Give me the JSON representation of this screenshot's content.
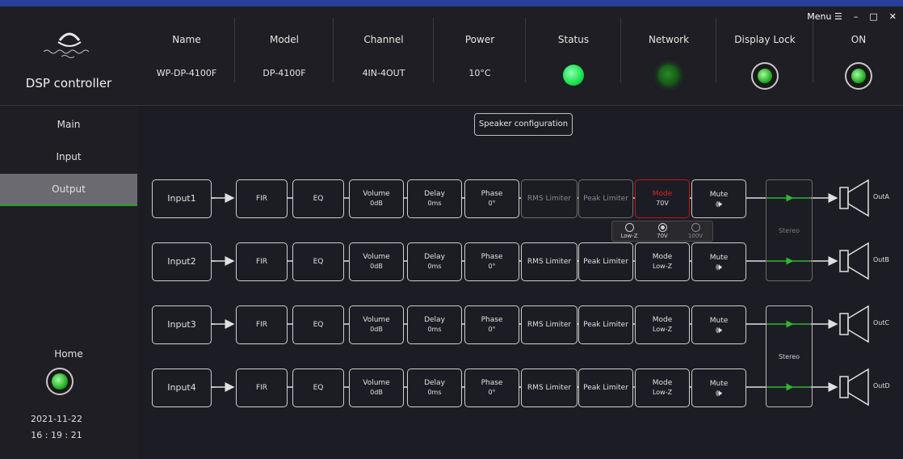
{
  "app": {
    "title": "DSP controller"
  },
  "window": {
    "menu_label": "Menu",
    "menu_icon": "☰",
    "minimize": "–",
    "maximize": "□",
    "close": "✕"
  },
  "header": {
    "name": {
      "label": "Name",
      "value": "WP-DP-4100F"
    },
    "model": {
      "label": "Model",
      "value": "DP-4100F"
    },
    "channel": {
      "label": "Channel",
      "value": "4IN-4OUT"
    },
    "power": {
      "label": "Power",
      "value": "10°C"
    },
    "status": {
      "label": "Status",
      "color": "#17e04a"
    },
    "network": {
      "label": "Network",
      "color": "#1a7a1a"
    },
    "display_lock": {
      "label": "Display Lock"
    },
    "on": {
      "label": "ON"
    }
  },
  "sidebar": {
    "items": [
      {
        "label": "Main"
      },
      {
        "label": "Input"
      },
      {
        "label": "Output",
        "active": true
      }
    ],
    "home_label": "Home",
    "date": "2021-11-22",
    "time": "16 : 19 : 21"
  },
  "main": {
    "speaker_config_label": "Speaker configuration",
    "channels": [
      {
        "input": "Input1",
        "fir": "FIR",
        "eq": "EQ",
        "volume": "Volume",
        "volume_val": "0dB",
        "delay": "Delay",
        "delay_val": "0ms",
        "phase": "Phase",
        "phase_val": "0°",
        "rms": "RMS Limiter",
        "peak": "Peak Limiter",
        "mode": "Mode",
        "mode_val": "70V",
        "mute": "Mute",
        "output": "OutA"
      },
      {
        "input": "Input2",
        "fir": "FIR",
        "eq": "EQ",
        "volume": "Volume",
        "volume_val": "0dB",
        "delay": "Delay",
        "delay_val": "0ms",
        "phase": "Phase",
        "phase_val": "0°",
        "rms": "RMS Limiter",
        "peak": "Peak Limiter",
        "mode": "Mode",
        "mode_val": "Low-Z",
        "mute": "Mute",
        "output": "OutB"
      },
      {
        "input": "Input3",
        "fir": "FIR",
        "eq": "EQ",
        "volume": "Volume",
        "volume_val": "0dB",
        "delay": "Delay",
        "delay_val": "0ms",
        "phase": "Phase",
        "phase_val": "0°",
        "rms": "RMS Limiter",
        "peak": "Peak Limiter",
        "mode": "Mode",
        "mode_val": "Low-Z",
        "mute": "Mute",
        "output": "OutC"
      },
      {
        "input": "Input4",
        "fir": "FIR",
        "eq": "EQ",
        "volume": "Volume",
        "volume_val": "0dB",
        "delay": "Delay",
        "delay_val": "0ms",
        "phase": "Phase",
        "phase_val": "0°",
        "rms": "RMS Limiter",
        "peak": "Peak Limiter",
        "mode": "Mode",
        "mode_val": "Low-Z",
        "mute": "Mute",
        "output": "OutD"
      }
    ],
    "stereo_label": "Stereo",
    "mode_popup": {
      "options": [
        "Low-Z",
        "70V",
        "100V"
      ],
      "selected": "70V"
    },
    "colors": {
      "accent_green": "#2fb82f",
      "alert_red": "#c01818"
    }
  }
}
